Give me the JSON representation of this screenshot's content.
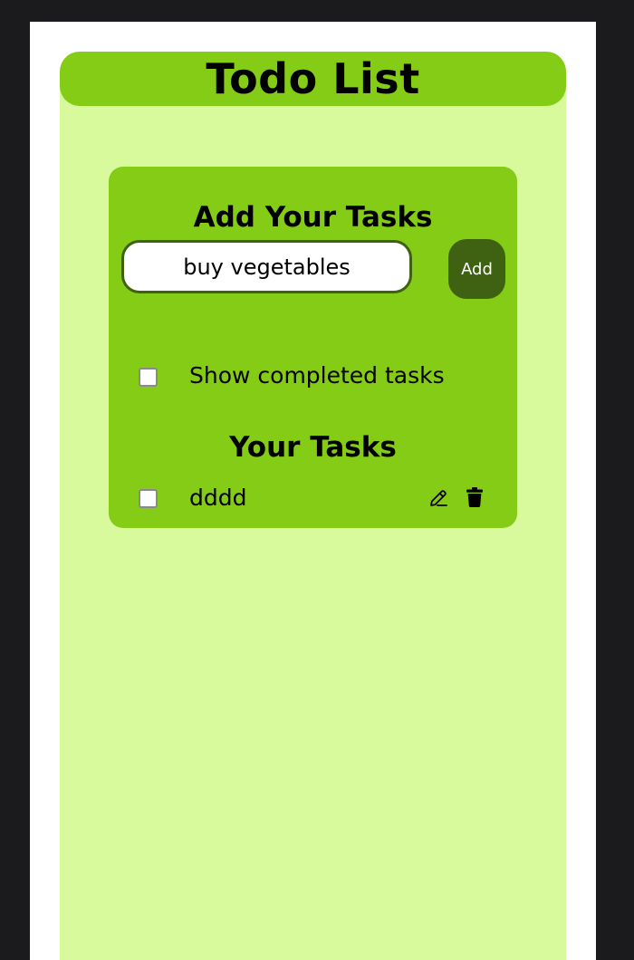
{
  "header": {
    "title": "Todo List"
  },
  "add_section": {
    "title": "Add Your Tasks",
    "input_value": "buy vegetables",
    "add_label": "Add"
  },
  "filter": {
    "show_completed_label": "Show completed tasks",
    "checked": false
  },
  "tasks_section": {
    "title": "Your Tasks",
    "items": [
      {
        "label": "dddd",
        "completed": false
      }
    ]
  },
  "icons": {
    "edit": "edit-pencil-icon",
    "delete": "trash-icon"
  },
  "colors": {
    "background": "#1b1b1d",
    "app_bg": "#d9f99d",
    "accent": "#84cc16",
    "button": "#3f6212"
  }
}
